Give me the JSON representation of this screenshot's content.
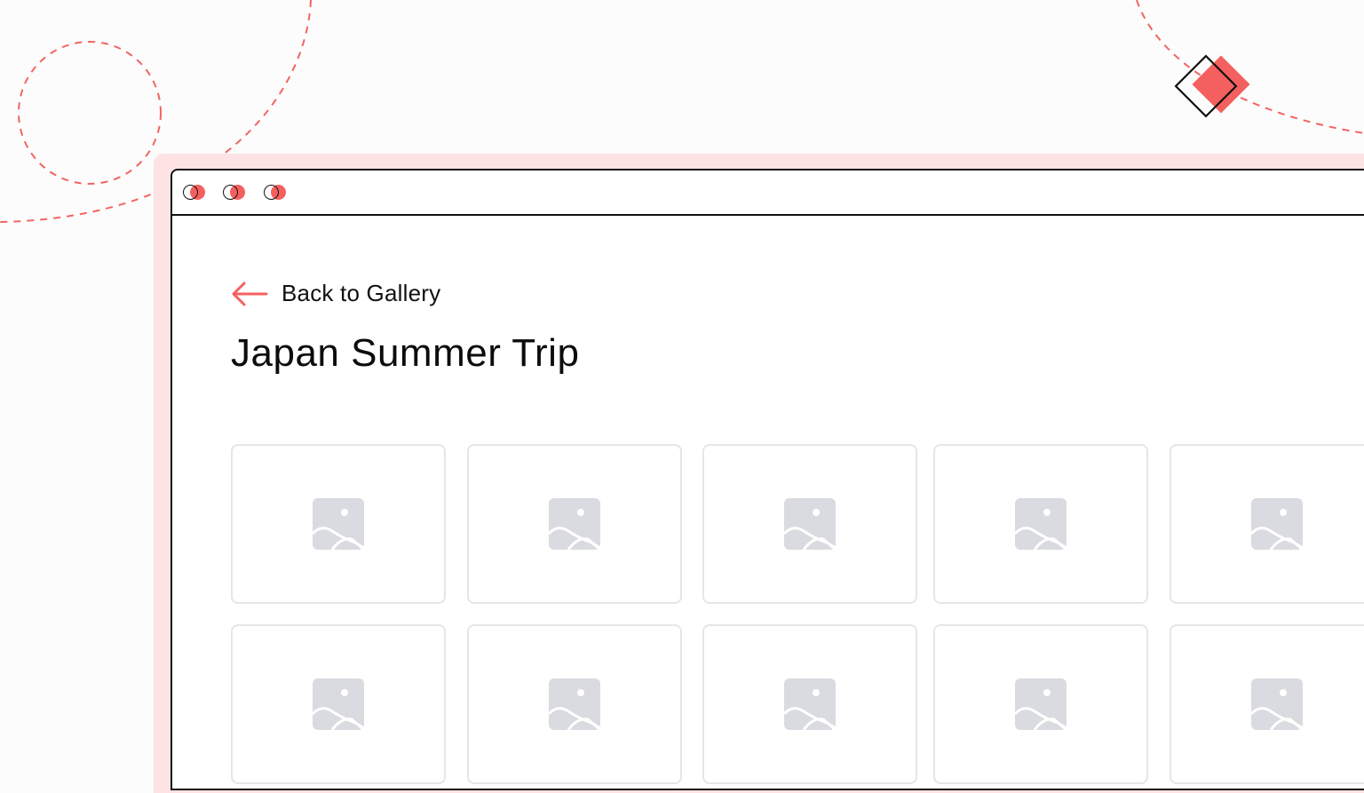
{
  "colors": {
    "accent": "#f4605f",
    "pink_frame": "#fde3e3",
    "placeholder": "#d9dbe0",
    "thumb_border": "#e6e6e8",
    "text": "#111111"
  },
  "window": {
    "controls": [
      {
        "icon": "window-dot-icon"
      },
      {
        "icon": "window-dot-icon"
      },
      {
        "icon": "window-dot-icon"
      }
    ]
  },
  "nav": {
    "back_icon": "arrow-left-icon",
    "back_label": "Back to Gallery"
  },
  "page": {
    "title": "Japan Summer Trip"
  },
  "gallery": {
    "thumbnail_icon": "image-placeholder-icon",
    "rows": 2,
    "columns": 5
  }
}
